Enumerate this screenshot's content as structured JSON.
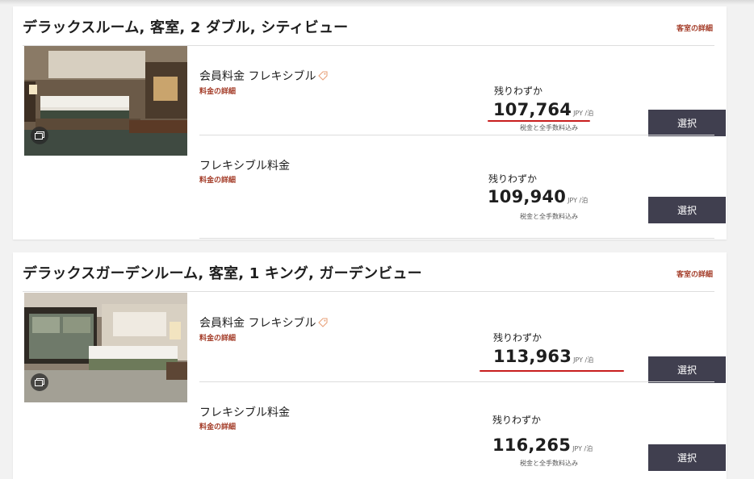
{
  "colors": {
    "accent": "#a33b27",
    "button_bg": "#403f4f",
    "annotation_red": "#c81e1e"
  },
  "rooms": [
    {
      "name": "デラックスルーム, 客室, 2 ダブル, シティビュー",
      "details_link": "客室の詳細",
      "photo_icon": "gallery-icon",
      "rates": [
        {
          "name": "会員料金 フレキシブル",
          "has_tag_icon": true,
          "details_link": "料金の詳細",
          "availability": "残りわずか",
          "price": "107,764",
          "unit": "JPY /泊",
          "tax_note": "税金と全手数料込み",
          "button": "選択",
          "annotated": true
        },
        {
          "name": "フレキシブル料金",
          "has_tag_icon": false,
          "details_link": "料金の詳細",
          "availability": "残りわずか",
          "price": "109,940",
          "unit": "JPY /泊",
          "tax_note": "税金と全手数料込み",
          "button": "選択",
          "annotated": false
        }
      ]
    },
    {
      "name": "デラックスガーデンルーム, 客室, 1 キング, ガーデンビュー",
      "details_link": "客室の詳細",
      "photo_icon": "gallery-icon",
      "rates": [
        {
          "name": "会員料金 フレキシブル",
          "has_tag_icon": true,
          "details_link": "料金の詳細",
          "availability": "残りわずか",
          "price": "113,963",
          "unit": "JPY /泊",
          "tax_note": "税金と全手数料込み",
          "button": "選択",
          "annotated": true
        },
        {
          "name": "フレキシブル料金",
          "has_tag_icon": false,
          "details_link": "料金の詳細",
          "availability": "残りわずか",
          "price": "116,265",
          "unit": "JPY /泊",
          "tax_note": "税金と全手数料込み",
          "button": "選択",
          "annotated": false
        }
      ]
    }
  ]
}
